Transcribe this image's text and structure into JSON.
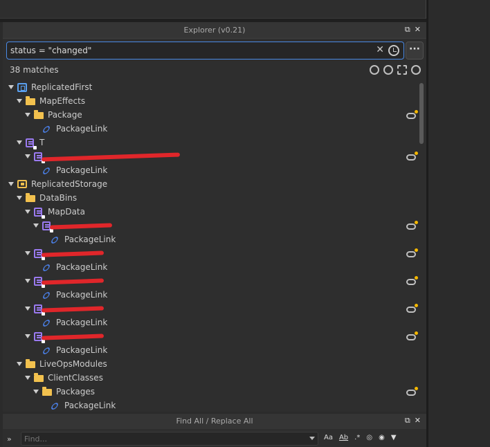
{
  "explorer": {
    "title": "Explorer (v0.21)",
    "search_value": "status = \"changed\"",
    "matches": "38 matches",
    "more_label": "···"
  },
  "tree": [
    {
      "label": "ReplicatedFirst",
      "icon": "replicated-first-icon",
      "level": 0,
      "expanded": true
    },
    {
      "label": "MapEffects",
      "icon": "folder-icon",
      "level": 1,
      "expanded": true
    },
    {
      "label": "Package",
      "icon": "folder-icon",
      "level": 2,
      "expanded": true,
      "sync": true
    },
    {
      "label": "PackageLink",
      "icon": "link-icon",
      "level": 3
    },
    {
      "label": "T",
      "icon": "module-script-icon",
      "level": 1,
      "expanded": true
    },
    {
      "label": "",
      "icon": "module-script-icon",
      "level": 2,
      "expanded": true,
      "sync": true,
      "redacted": true
    },
    {
      "label": "PackageLink",
      "icon": "link-icon",
      "level": 3
    },
    {
      "label": "ReplicatedStorage",
      "icon": "replicated-storage-icon",
      "level": 0,
      "expanded": true
    },
    {
      "label": "DataBins",
      "icon": "folder-icon",
      "level": 1,
      "expanded": true
    },
    {
      "label": "MapData",
      "icon": "module-script-icon",
      "level": 2,
      "expanded": true
    },
    {
      "label": "",
      "icon": "module-script-icon",
      "level": 3,
      "expanded": true,
      "sync": true,
      "redacted": true
    },
    {
      "label": "PackageLink",
      "icon": "link-icon",
      "level": 4
    },
    {
      "label": "",
      "icon": "module-script-icon",
      "level": 2,
      "expanded": true,
      "sync": true,
      "redacted": true
    },
    {
      "label": "PackageLink",
      "icon": "link-icon",
      "level": 3
    },
    {
      "label": "",
      "icon": "module-script-icon",
      "level": 2,
      "expanded": true,
      "sync": true,
      "redacted": true
    },
    {
      "label": "PackageLink",
      "icon": "link-icon",
      "level": 3
    },
    {
      "label": "",
      "icon": "module-script-icon",
      "level": 2,
      "expanded": true,
      "sync": true,
      "redacted": true
    },
    {
      "label": "PackageLink",
      "icon": "link-icon",
      "level": 3
    },
    {
      "label": "",
      "icon": "module-script-icon",
      "level": 2,
      "expanded": true,
      "sync": true,
      "redacted": true
    },
    {
      "label": "PackageLink",
      "icon": "link-icon",
      "level": 3
    },
    {
      "label": "LiveOpsModules",
      "icon": "folder-icon",
      "level": 1,
      "expanded": true
    },
    {
      "label": "ClientClasses",
      "icon": "folder-icon",
      "level": 2,
      "expanded": true
    },
    {
      "label": "Packages",
      "icon": "folder-icon",
      "level": 3,
      "expanded": true,
      "sync": true
    },
    {
      "label": "PackageLink",
      "icon": "link-icon",
      "level": 4
    }
  ],
  "find": {
    "title": "Find All / Replace All",
    "placeholder": "Find...",
    "opt_case": "Aa",
    "opt_word": "Ab",
    "opt_regex": ".*"
  },
  "colors": {
    "accent": "#4a8ae6",
    "folder": "#f2c14e",
    "script": "#9a7af0",
    "link": "#4a7fe6",
    "changed_dot": "#f5b800",
    "redaction": "#e0262a"
  }
}
